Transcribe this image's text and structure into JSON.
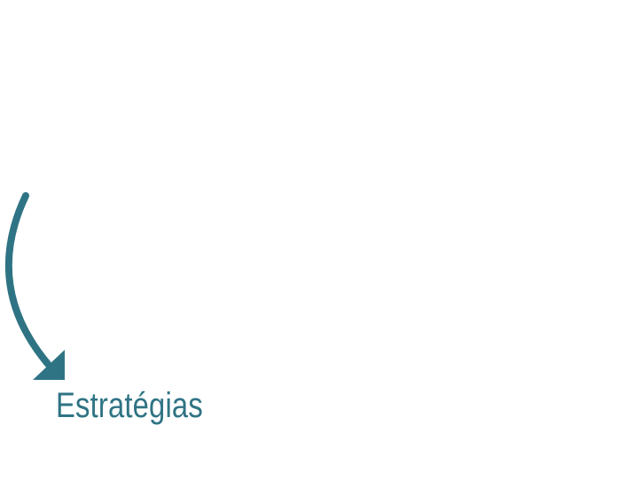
{
  "label": {
    "text": "Estratégias"
  },
  "colors": {
    "accent": "#2f7484",
    "background": "#ffffff"
  },
  "icons": {
    "arrow": "curved-arrow-down-right-icon"
  }
}
